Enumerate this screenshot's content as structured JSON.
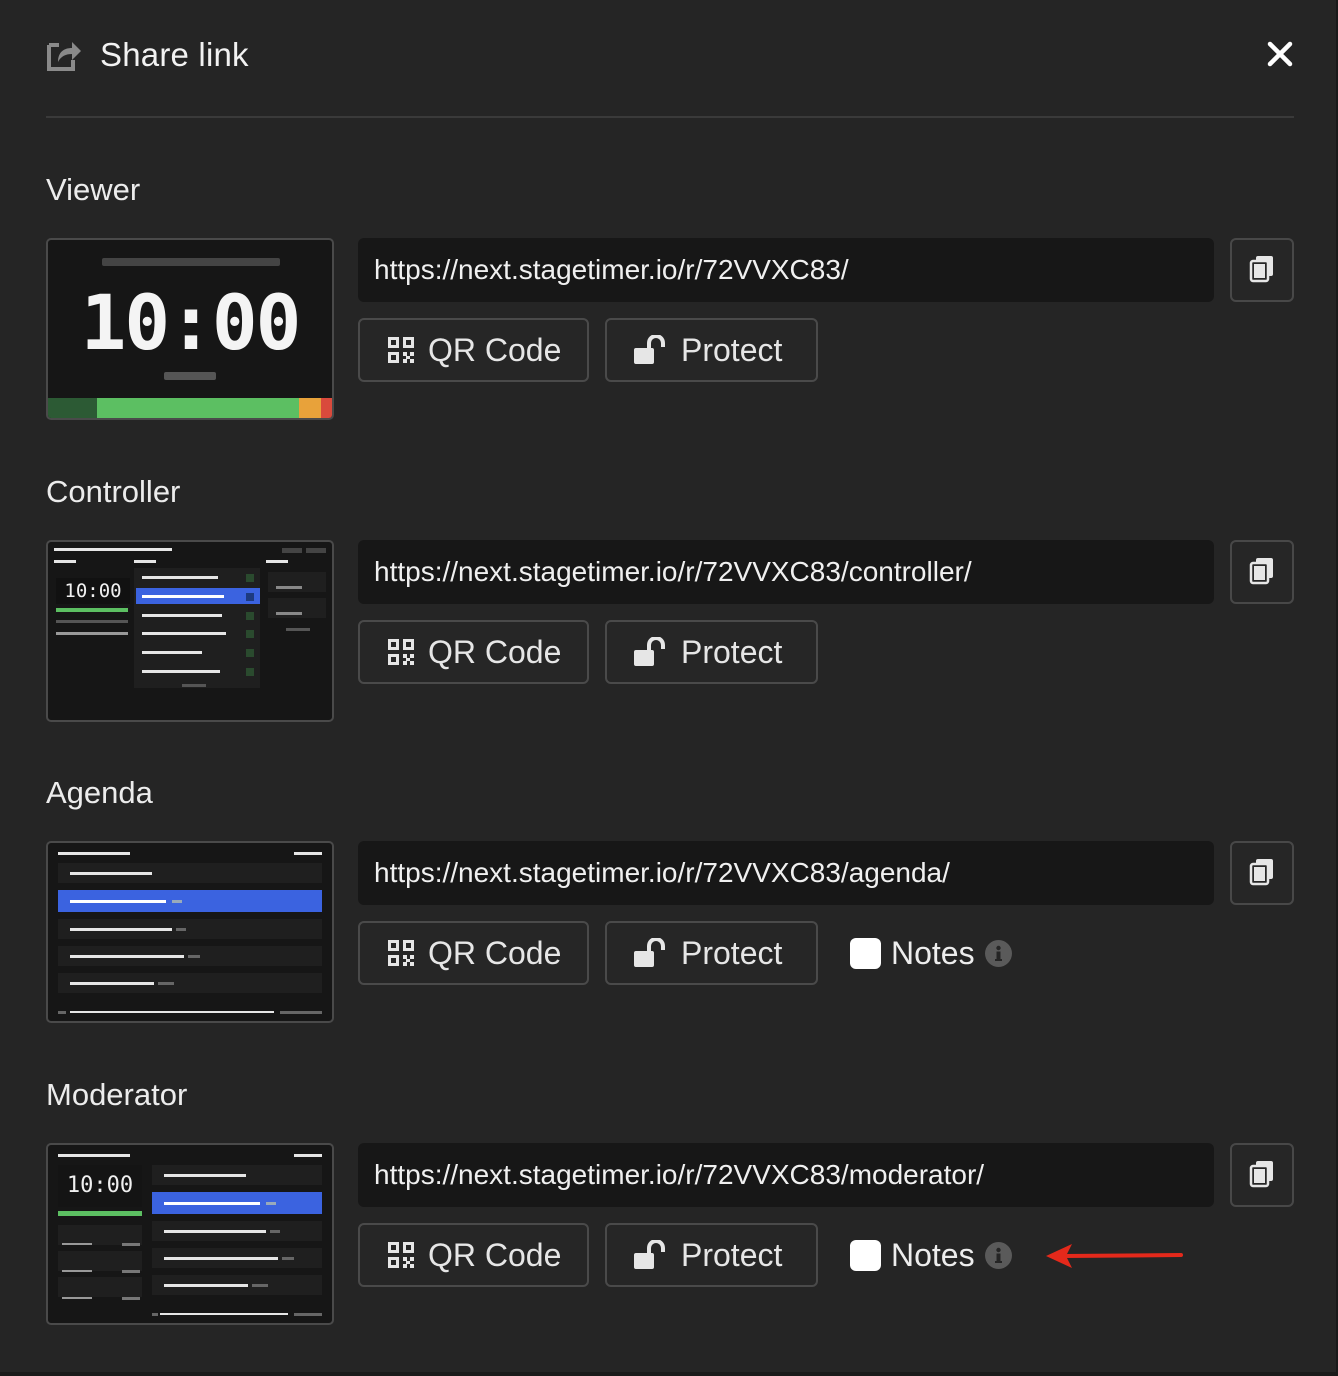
{
  "dialog": {
    "title": "Share link",
    "close_icon": "close-icon",
    "share_icon": "share-icon"
  },
  "sections": [
    {
      "label": "Viewer",
      "url": "https://next.stagetimer.io/r/72VVXC83/",
      "qr_label": "QR Code",
      "protect_label": "Protect"
    },
    {
      "label": "Controller",
      "url": "https://next.stagetimer.io/r/72VVXC83/controller/",
      "qr_label": "QR Code",
      "protect_label": "Protect"
    },
    {
      "label": "Agenda",
      "url": "https://next.stagetimer.io/r/72VVXC83/agenda/",
      "qr_label": "QR Code",
      "protect_label": "Protect",
      "notes_label": "Notes",
      "notes_checked": false
    },
    {
      "label": "Moderator",
      "url": "https://next.stagetimer.io/r/72VVXC83/moderator/",
      "qr_label": "QR Code",
      "protect_label": "Protect",
      "notes_label": "Notes",
      "notes_checked": false
    }
  ],
  "previews": {
    "viewer_time": "10:00",
    "controller_time": "10:00",
    "moderator_time": "10:00"
  },
  "colors": {
    "background": "#252525",
    "url_background": "#171717",
    "accent_blue": "#3b63e0",
    "progress_green": "#5cbf62",
    "progress_dark_green": "#2c5a34",
    "progress_orange": "#e8a23a",
    "progress_red": "#d94a3c",
    "annotation_arrow": "#e4291b"
  }
}
